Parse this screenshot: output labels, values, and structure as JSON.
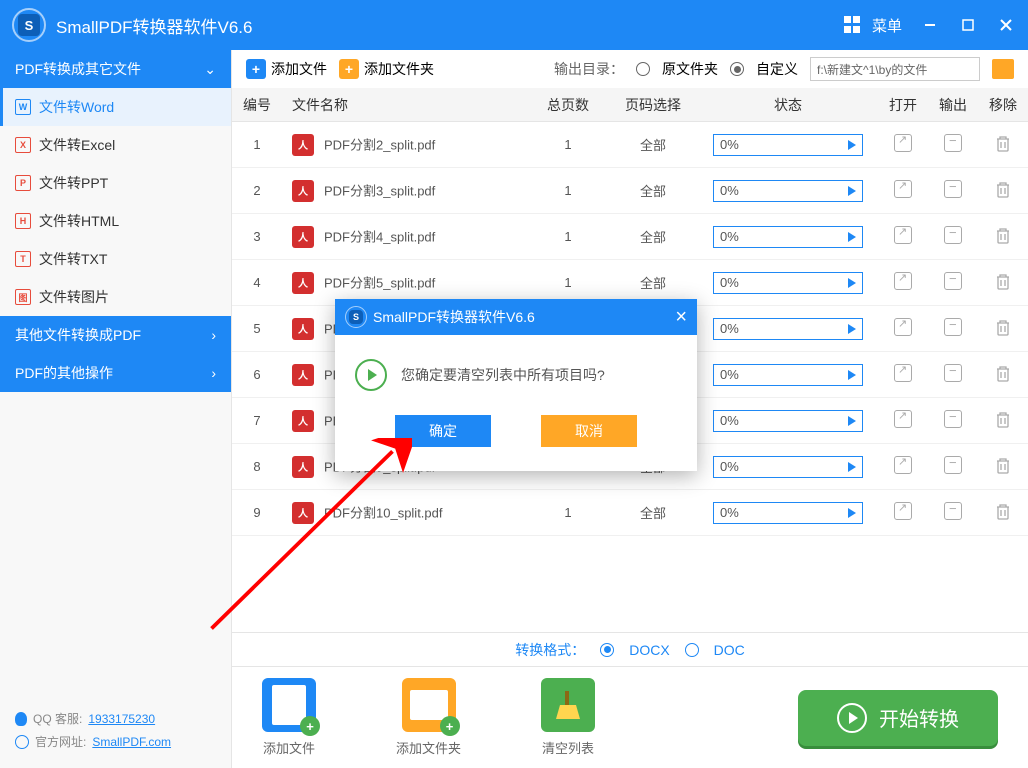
{
  "app": {
    "title": "SmallPDF转换器软件V6.6",
    "menu": "菜单"
  },
  "sidebar": {
    "header1": "PDF转换成其它文件",
    "items": [
      {
        "label": "文件转Word",
        "letter": "W"
      },
      {
        "label": "文件转Excel",
        "letter": "X"
      },
      {
        "label": "文件转PPT",
        "letter": "P"
      },
      {
        "label": "文件转HTML",
        "letter": "H"
      },
      {
        "label": "文件转TXT",
        "letter": "T"
      },
      {
        "label": "文件转图片",
        "letter": "图"
      }
    ],
    "header2": "其他文件转换成PDF",
    "header3": "PDF的其他操作"
  },
  "toolbar": {
    "add_file": "添加文件",
    "add_folder": "添加文件夹",
    "output_label": "输出目录：",
    "radio_source": "原文件夹",
    "radio_custom": "自定义",
    "path": "f:\\新建文^1\\by的文件"
  },
  "table": {
    "headers": {
      "num": "编号",
      "name": "文件名称",
      "pages": "总页数",
      "select": "页码选择",
      "status": "状态",
      "open": "打开",
      "output": "输出",
      "remove": "移除"
    },
    "rows": [
      {
        "n": "1",
        "name": "PDF分割2_split.pdf",
        "pages": "1",
        "sel": "全部",
        "pct": "0%"
      },
      {
        "n": "2",
        "name": "PDF分割3_split.pdf",
        "pages": "1",
        "sel": "全部",
        "pct": "0%"
      },
      {
        "n": "3",
        "name": "PDF分割4_split.pdf",
        "pages": "1",
        "sel": "全部",
        "pct": "0%"
      },
      {
        "n": "4",
        "name": "PDF分割5_split.pdf",
        "pages": "1",
        "sel": "全部",
        "pct": "0%"
      },
      {
        "n": "5",
        "name": "PDF分",
        "pages": "",
        "sel": "",
        "pct": "0%"
      },
      {
        "n": "6",
        "name": "PDF分",
        "pages": "",
        "sel": "",
        "pct": "0%"
      },
      {
        "n": "7",
        "name": "PDF分",
        "pages": "",
        "sel": "",
        "pct": "0%"
      },
      {
        "n": "8",
        "name": "PDF分割9_split.pdf",
        "pages": "1",
        "sel": "全部",
        "pct": "0%"
      },
      {
        "n": "9",
        "name": "PDF分割10_split.pdf",
        "pages": "1",
        "sel": "全部",
        "pct": "0%"
      }
    ]
  },
  "format": {
    "label": "转换格式：",
    "docx": "DOCX",
    "doc": "DOC"
  },
  "bottom": {
    "add_file": "添加文件",
    "add_folder": "添加文件夹",
    "clear_list": "清空列表",
    "convert": "开始转换"
  },
  "footer": {
    "qq_label": "QQ 客服:",
    "qq": "1933175230",
    "web_label": "官方网址:",
    "web": "SmallPDF.com"
  },
  "dialog": {
    "title": "SmallPDF转换器软件V6.6",
    "message": "您确定要清空列表中所有项目吗?",
    "ok": "确定",
    "cancel": "取消"
  }
}
